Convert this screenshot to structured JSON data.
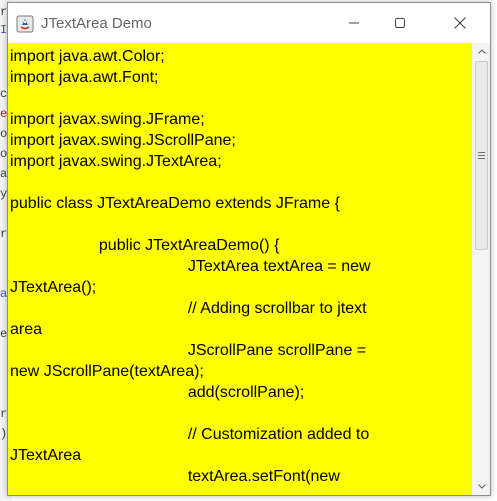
{
  "window": {
    "title": "JTextArea Demo"
  },
  "text_area": {
    "background": "#ffff00",
    "lines": [
      "import java.awt.Color;",
      "import java.awt.Font;",
      "",
      "import javax.swing.JFrame;",
      "import javax.swing.JScrollPane;",
      "import javax.swing.JTextArea;",
      "",
      "public class JTextAreaDemo extends JFrame {",
      "",
      "                    public JTextAreaDemo() {",
      "                                        JTextArea textArea = new",
      "JTextArea();",
      "                                        // Adding scrollbar to jtext",
      "area",
      "                                        JScrollPane scrollPane =",
      "new JScrollPane(textArea);",
      "                                        add(scrollPane);",
      "",
      "                                        // Customization added to",
      "JTextArea",
      "                                        textArea.setFont(new"
    ]
  },
  "icons": {
    "app": "java-app-icon",
    "minimize": "minimize-icon",
    "maximize": "maximize-icon",
    "close": "close-icon"
  }
}
